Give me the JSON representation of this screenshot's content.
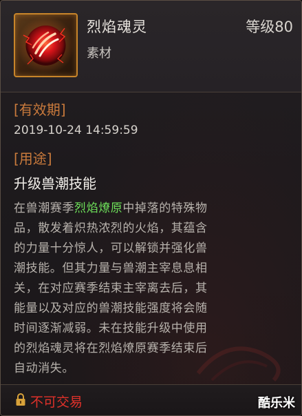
{
  "header": {
    "item_name": "烈焰魂灵",
    "item_type": "素材",
    "level_text": "等级80",
    "icon": "fire-orb-icon"
  },
  "validity": {
    "title": "[有效期]",
    "date": "2019-10-24 14:59:59"
  },
  "usage": {
    "title": "[用途]",
    "text": "升级兽潮技能"
  },
  "description": {
    "line1_pre": "在兽潮赛季",
    "line1_highlight": "烈焰燎原",
    "line1_post": "中掉落的特殊物",
    "lines": [
      "品，散发着炽热浓烈的火焰，其蕴含",
      "的力量十分惊人，可以解锁并强化兽",
      "潮技能。但其力量与兽潮主宰息息相",
      "关，在对应赛季结束主宰离去后，其",
      "能量以及对应的兽潮技能强度将会随",
      "时间逐渐减弱。未在技能升级中使用",
      "的烈焰魂灵将在烈焰燎原赛季结束后",
      "自动消失。"
    ]
  },
  "footer": {
    "trade_status": "不可交易",
    "lock_icon": "lock-icon",
    "watermark": "酷乐米"
  },
  "colors": {
    "section_title": "#c97a3c",
    "highlight": "#6ee05a",
    "untradeable": "#e0312a",
    "icon_border": "#c8852a"
  }
}
